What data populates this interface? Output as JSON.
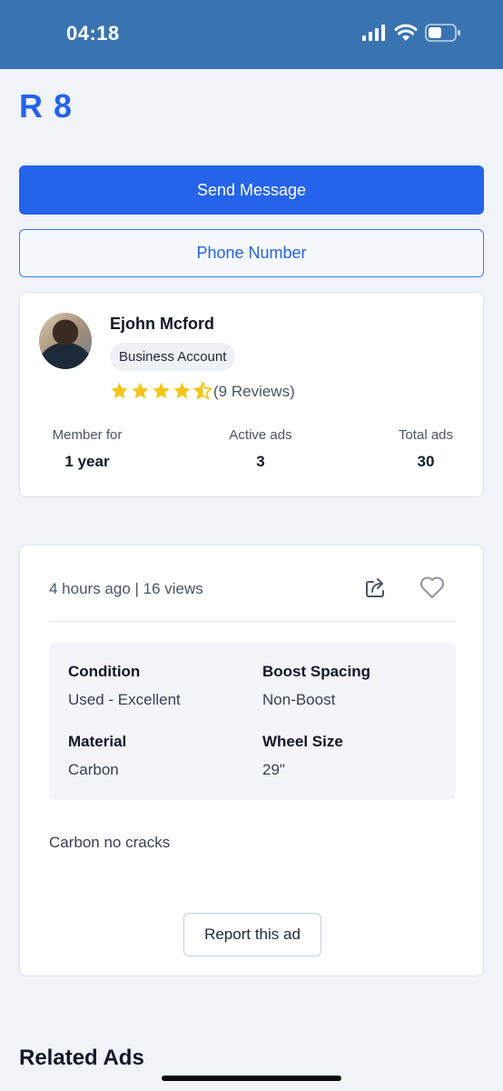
{
  "status_bar": {
    "time": "04:18"
  },
  "listing": {
    "title": "R 8",
    "send_message_label": "Send Message",
    "phone_number_label": "Phone Number"
  },
  "seller": {
    "name": "Ejohn Mcford",
    "account_type": "Business Account",
    "rating": 4.5,
    "reviews_label": "(9 Reviews)",
    "stats": [
      {
        "label": "Member for",
        "value": "1 year"
      },
      {
        "label": "Active ads",
        "value": "3"
      },
      {
        "label": "Total ads",
        "value": "30"
      }
    ]
  },
  "details": {
    "meta": "4 hours ago | 16 views",
    "specs": [
      {
        "label": "Condition",
        "value": "Used - Excellent"
      },
      {
        "label": "Boost Spacing",
        "value": "Non-Boost"
      },
      {
        "label": "Material",
        "value": "Carbon"
      },
      {
        "label": "Wheel Size",
        "value": "29\""
      }
    ],
    "description": "Carbon no cracks",
    "report_label": "Report this ad"
  },
  "related": {
    "title": "Related Ads"
  },
  "colors": {
    "accent": "#2563eb",
    "status_bar": "#3a74b0",
    "star": "#f5c518"
  },
  "icons": [
    "signal-icon",
    "wifi-icon",
    "battery-icon",
    "star-icon",
    "half-star-icon",
    "share-icon",
    "heart-icon"
  ]
}
